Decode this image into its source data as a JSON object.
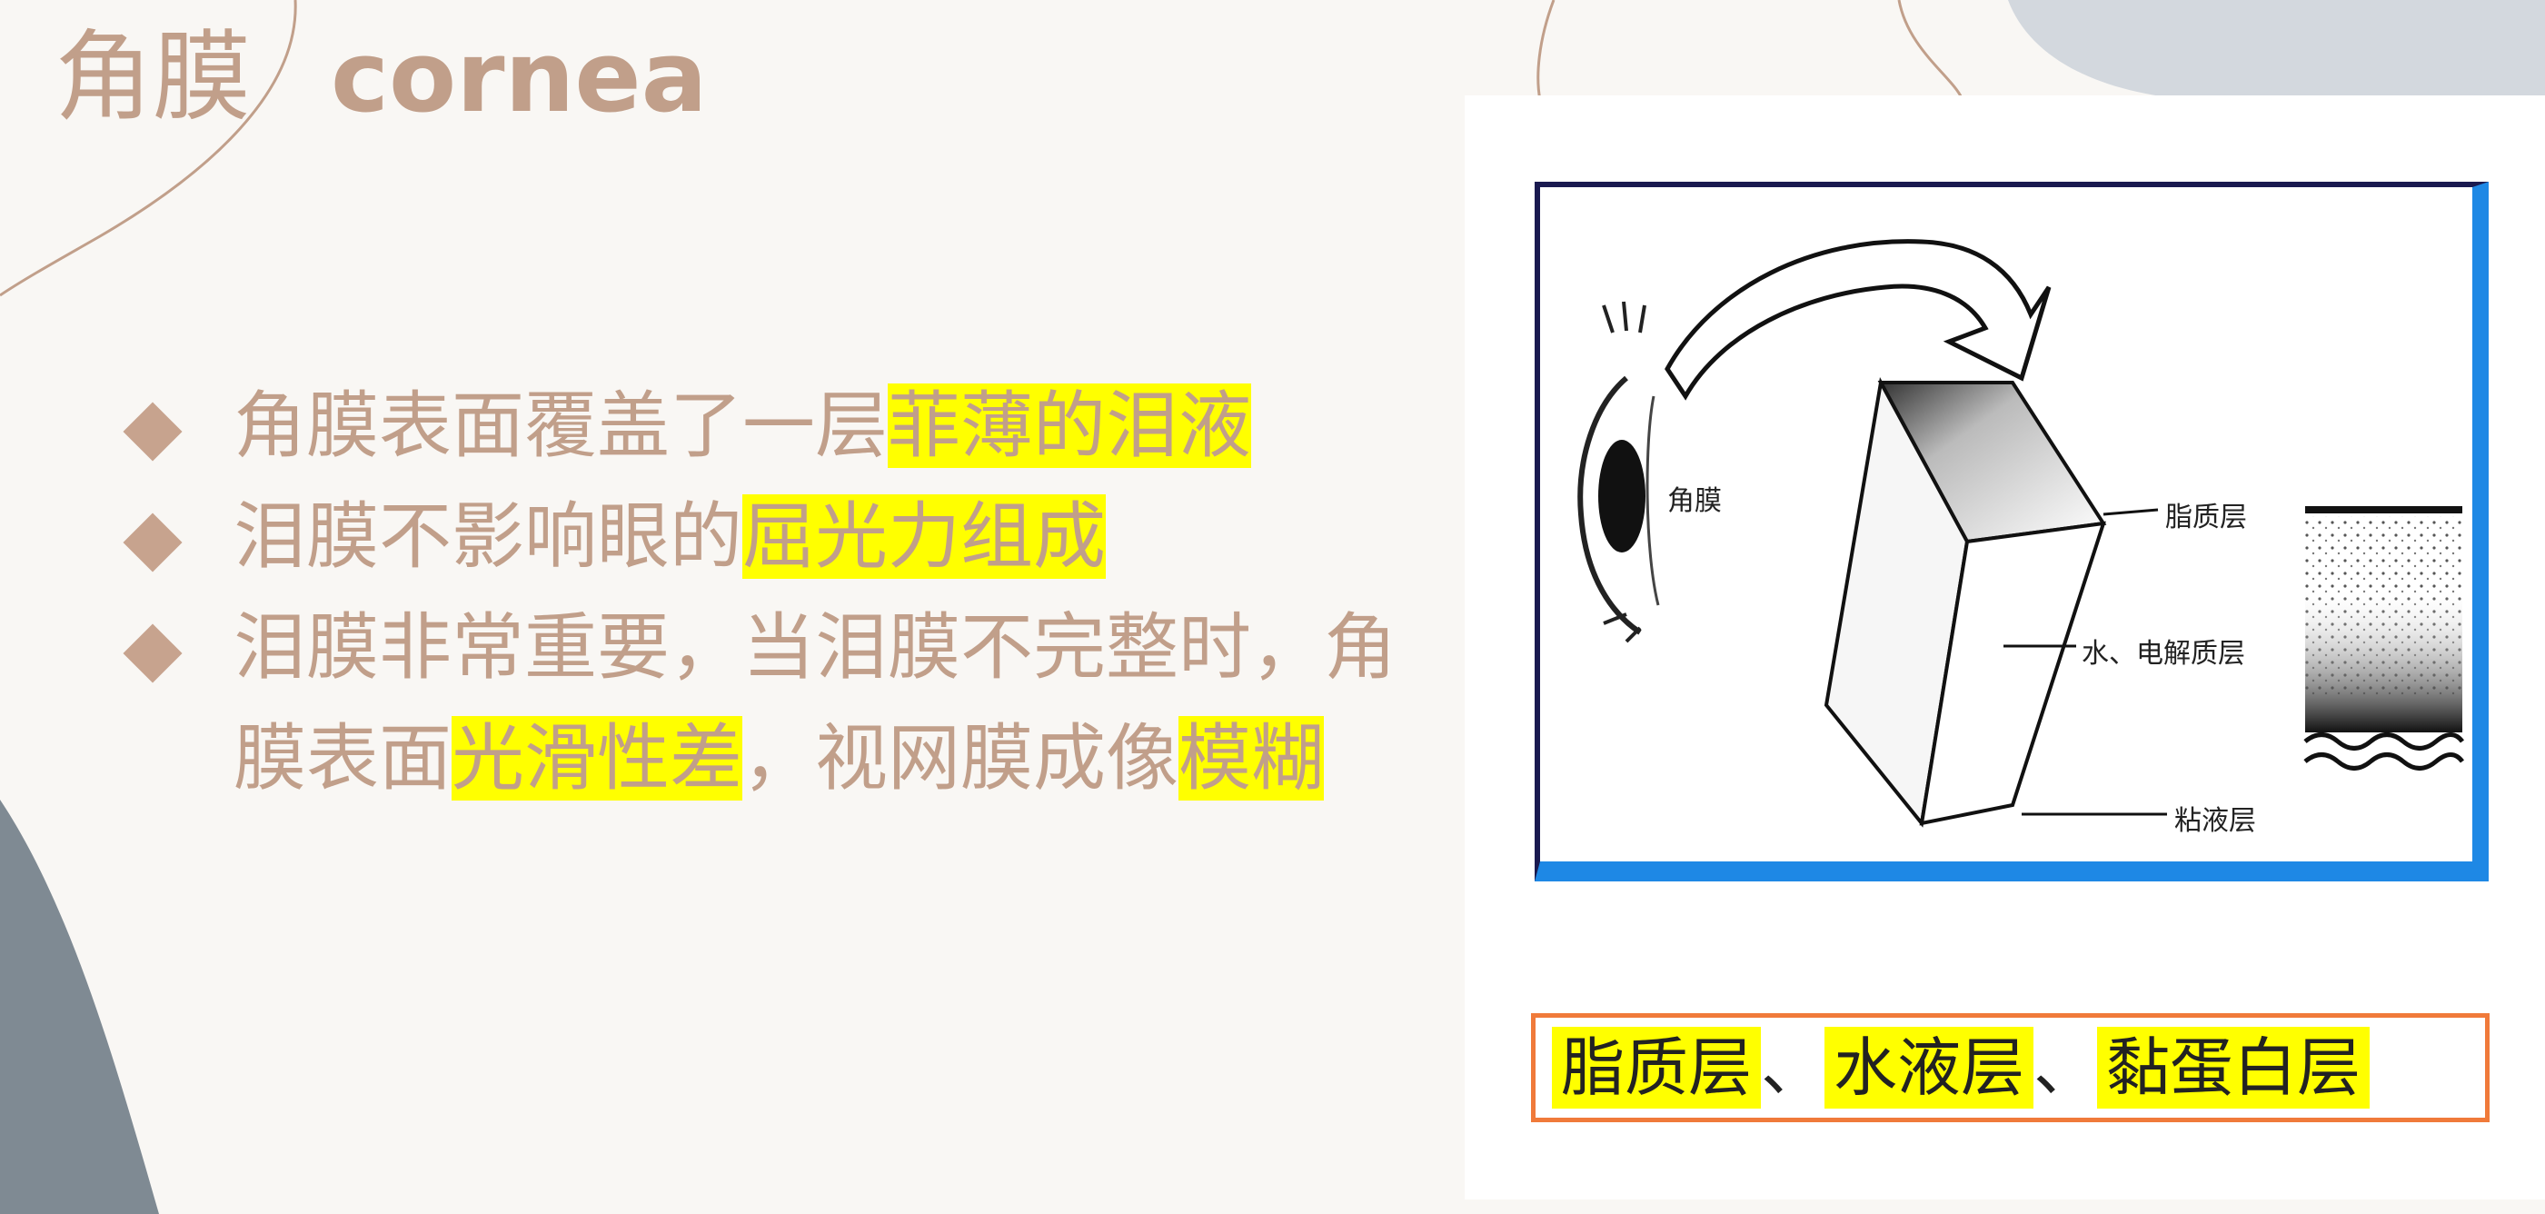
{
  "title": {
    "zh": "角膜",
    "en": "cornea"
  },
  "bullets": [
    {
      "segments": [
        {
          "text": "角膜表面覆盖了一层",
          "hl": false
        },
        {
          "text": "菲薄的泪液",
          "hl": true
        }
      ]
    },
    {
      "segments": [
        {
          "text": "泪膜不影响眼的",
          "hl": false
        },
        {
          "text": "屈光力组成",
          "hl": true
        }
      ]
    },
    {
      "segments": [
        {
          "text": "泪膜非常重要，当泪膜不完整时，角膜表面",
          "hl": false
        },
        {
          "text": "光滑性差",
          "hl": true
        },
        {
          "text": "，视网膜成像",
          "hl": false
        },
        {
          "text": "模糊",
          "hl": true
        }
      ]
    }
  ],
  "figure": {
    "labels": {
      "cornea": "角膜",
      "lipid": "脂质层",
      "water": "水、电解质层",
      "mucus": "粘液层"
    },
    "caption": {
      "lipid": "脂质层",
      "sep1": "、",
      "aqueous": "水液层",
      "sep2": "、",
      "mucin": "黏蛋白层"
    }
  },
  "colors": {
    "text": "#c19f8a",
    "highlight": "#ffff00",
    "accent_slate": "#7f8a93",
    "accent_light": "#d3d8de"
  }
}
